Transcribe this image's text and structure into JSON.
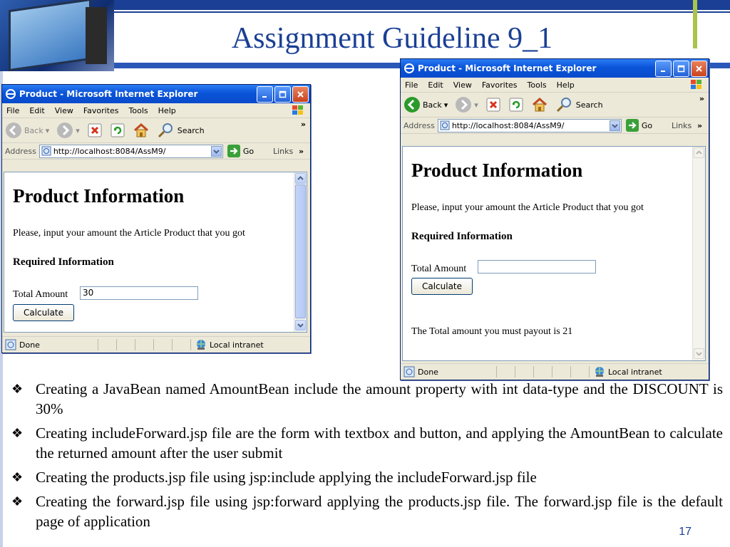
{
  "slide": {
    "title": "Assignment Guideline 9_1",
    "page_number": "17",
    "bullet_glyph": "❖",
    "bullets": [
      "Creating a JavaBean named AmountBean include the amount property with int data-type and the DISCOUNT is 30%",
      "Creating includeForward.jsp file are the form with textbox and button, and applying the AmountBean to calculate the returned amount after the user submit",
      "Creating the products.jsp file using jsp:include applying the includeForward.jsp file",
      "Creating the forward.jsp file using jsp:forward applying the products.jsp file. The forward.jsp file is the default page of application"
    ]
  },
  "browser_left": {
    "window_title": "Product - Microsoft Internet Explorer",
    "menu": [
      "File",
      "Edit",
      "View",
      "Favorites",
      "Tools",
      "Help"
    ],
    "back_label": "Back",
    "search_label": "Search",
    "address_label": "Address",
    "url": "http://localhost:8084/AssM9/",
    "go_label": "Go",
    "links_label": "Links",
    "more": "»",
    "page": {
      "heading": "Product Information",
      "description": "Please, input your amount the Article Product that you got",
      "required": "Required Information",
      "amount_label": "Total Amount",
      "amount_value": "30",
      "button": "Calculate"
    },
    "status": "Done",
    "zone": "Local intranet"
  },
  "browser_right": {
    "window_title": "Product - Microsoft Internet Explorer",
    "menu": [
      "File",
      "Edit",
      "View",
      "Favorites",
      "Tools",
      "Help"
    ],
    "back_label": "Back",
    "search_label": "Search",
    "address_label": "Address",
    "url": "http://localhost:8084/AssM9/",
    "go_label": "Go",
    "links_label": "Links",
    "more": "»",
    "page": {
      "heading": "Product Information",
      "description": "Please, input your amount the Article Product that you got",
      "required": "Required Information",
      "amount_label": "Total Amount",
      "amount_value": "",
      "button": "Calculate",
      "result": "The Total amount you must payout is 21"
    },
    "status": "Done",
    "zone": "Local intranet"
  },
  "colors": {
    "title_blue": "#1a3f95",
    "accent_green": "#a9c34b",
    "xp_title": "#0a54d8"
  }
}
